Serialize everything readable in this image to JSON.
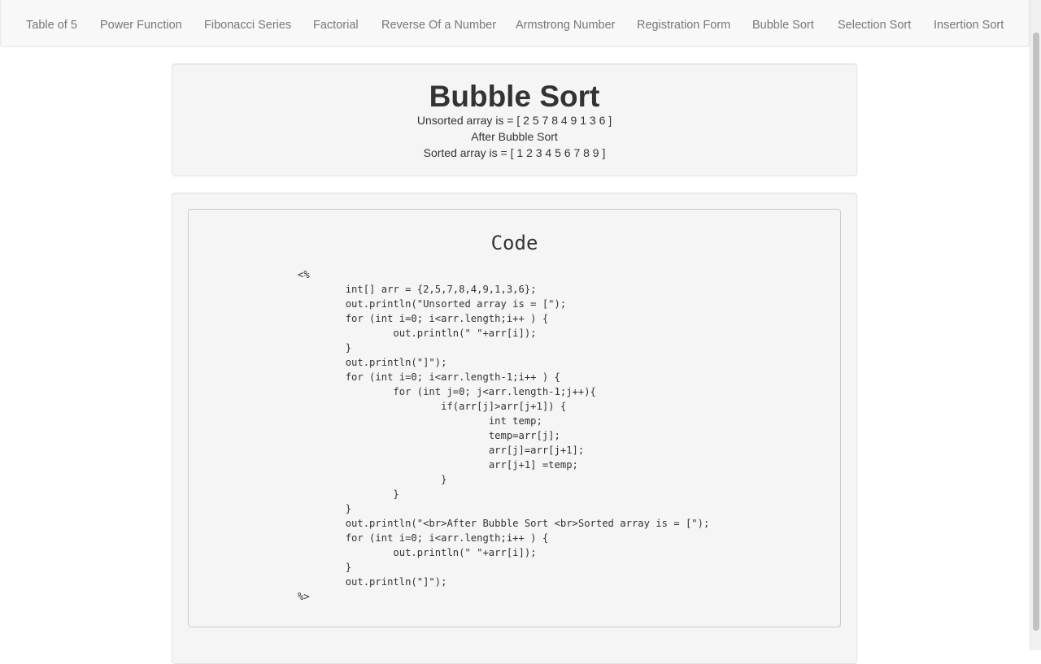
{
  "nav": {
    "items": [
      "Table of 5",
      "Power Function",
      "Fibonacci Series",
      "Factorial",
      "Reverse Of a Number",
      "Armstrong Number",
      "Registration Form",
      "Bubble Sort",
      "Selection Sort",
      "Insertion Sort"
    ]
  },
  "result": {
    "title": "Bubble Sort",
    "unsorted": "Unsorted array is = [ 2 5 7 8 4 9 1 3 6 ]",
    "after": "After Bubble Sort",
    "sorted": "Sorted array is = [ 1 2 3 4 5 6 7 8 9 ]"
  },
  "code": {
    "title": "Code",
    "source": "<%\n\tint[] arr = {2,5,7,8,4,9,1,3,6};\n\tout.println(\"Unsorted array is = [\");\n\tfor (int i=0; i<arr.length;i++ ) {\n\t\tout.println(\" \"+arr[i]);\n\t}\n\tout.println(\"]\");\n\tfor (int i=0; i<arr.length-1;i++ ) {\n\t\tfor (int j=0; j<arr.length-1;j++){\n\t\t\tif(arr[j]>arr[j+1]) {\n\t\t\t\tint temp;\n\t\t\t\ttemp=arr[j];\n\t\t\t\tarr[j]=arr[j+1];\n\t\t\t\tarr[j+1] =temp;\n\t\t\t}\n\t\t}\n\t}\n\tout.println(\"<br>After Bubble Sort <br>Sorted array is = [\");\n\tfor (int i=0; i<arr.length;i++ ) {\n\t\tout.println(\" \"+arr[i]);\n\t}\n\tout.println(\"]\");\n%>"
  }
}
